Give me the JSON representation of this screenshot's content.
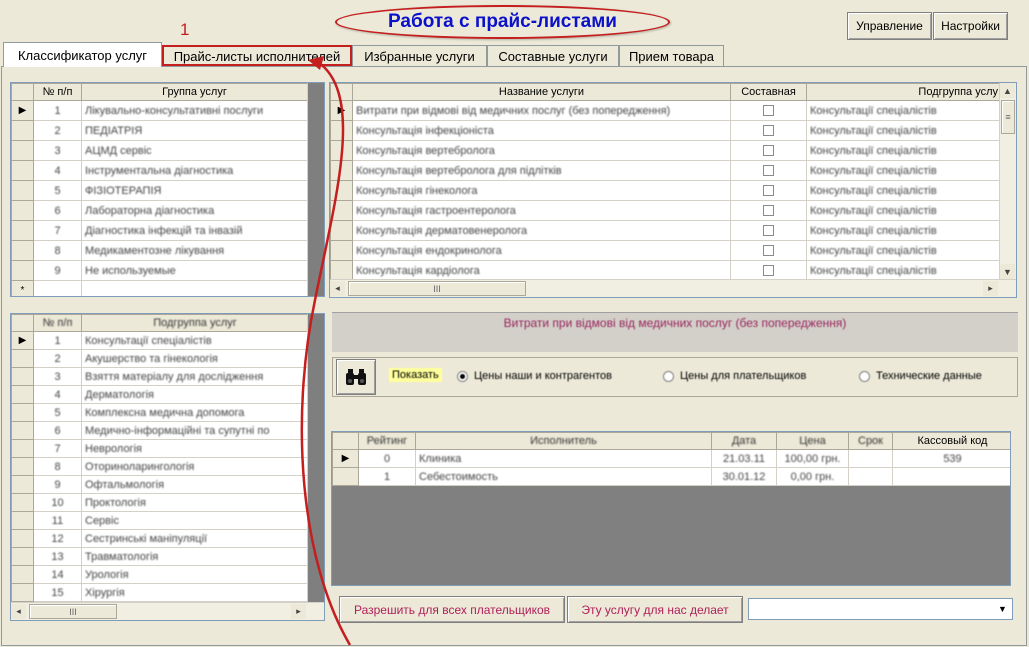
{
  "window": {
    "title": "Работа с прайс-листами",
    "annotation_number": "1",
    "buttons": {
      "manage": "Управление",
      "settings": "Настройки"
    }
  },
  "tabs": [
    {
      "label": "Классификатор услуг",
      "active": true
    },
    {
      "label": "Прайс-листы исполнителей",
      "highlighted": true
    },
    {
      "label": "Избранные услуги"
    },
    {
      "label": "Составные услуги"
    },
    {
      "label": "Прием товара"
    }
  ],
  "groups_grid": {
    "headers": {
      "num": "№ п/п",
      "name": "Группа услуг"
    },
    "rows": [
      {
        "num": "1",
        "name": "Лікувально-консультативні послуги"
      },
      {
        "num": "2",
        "name": "ПЕДІАТРІЯ"
      },
      {
        "num": "3",
        "name": "АЦМД сервіс"
      },
      {
        "num": "4",
        "name": "Інструментальна діагностика"
      },
      {
        "num": "5",
        "name": "ФІЗІОТЕРАПІЯ"
      },
      {
        "num": "6",
        "name": "Лабораторна діагностика"
      },
      {
        "num": "7",
        "name": "Діагностика інфекцій та інвазій"
      },
      {
        "num": "8",
        "name": "Медикаментозне лікування"
      },
      {
        "num": "9",
        "name": "Не используемые"
      }
    ],
    "new_row_marker": "*",
    "current_marker": "▶"
  },
  "subgroups_grid": {
    "headers": {
      "num": "№ п/п",
      "name": "Подгруппа услуг"
    },
    "rows": [
      {
        "num": "1",
        "name": "Консультації спеціалістів"
      },
      {
        "num": "2",
        "name": "Акушерство та гінекологія"
      },
      {
        "num": "3",
        "name": "Взяття матеріалу для дослідження"
      },
      {
        "num": "4",
        "name": "Дерматологія"
      },
      {
        "num": "5",
        "name": "Комплексна медична допомога"
      },
      {
        "num": "6",
        "name": "Медично-інформаційні та супутні по"
      },
      {
        "num": "7",
        "name": "Неврологія"
      },
      {
        "num": "8",
        "name": "Оториноларингологія"
      },
      {
        "num": "9",
        "name": "Офтальмологія"
      },
      {
        "num": "10",
        "name": "Проктологія"
      },
      {
        "num": "11",
        "name": "Сервіс"
      },
      {
        "num": "12",
        "name": "Сестринські маніпуляції"
      },
      {
        "num": "13",
        "name": "Травматологія"
      },
      {
        "num": "14",
        "name": "Урологія"
      },
      {
        "num": "15",
        "name": "Хірургія"
      }
    ]
  },
  "services_grid": {
    "headers": {
      "name": "Название услуги",
      "composite": "Составная",
      "subgroup": "Подгруппа услу"
    },
    "rows": [
      {
        "name": "Витрати при відмові від медичних послуг (без попередження)",
        "subgroup": "Консультації спеціалістів"
      },
      {
        "name": "Консультація інфекціоніста",
        "subgroup": "Консультації спеціалістів"
      },
      {
        "name": "Консультація вертебролога",
        "subgroup": "Консультації спеціалістів"
      },
      {
        "name": "Консультація вертебролога для підлітків",
        "subgroup": "Консультації спеціалістів"
      },
      {
        "name": "Консультація гінеколога",
        "subgroup": "Консультації спеціалістів"
      },
      {
        "name": "Консультація гастроентеролога",
        "subgroup": "Консультації спеціалістів"
      },
      {
        "name": "Консультація дерматовенеролога",
        "subgroup": "Консультації спеціалістів"
      },
      {
        "name": "Консультація ендокринолога",
        "subgroup": "Консультації спеціалістів"
      },
      {
        "name": "Консультація кардіолога",
        "subgroup": "Консультації спеціалістів"
      }
    ]
  },
  "selected_service_banner": "Витрати при відмові від медичних послуг (без попередження)",
  "filter": {
    "show_label": "Показать",
    "options": [
      {
        "label": "Цены наши и контрагентов",
        "checked": true
      },
      {
        "label": "Цены для плательщиков",
        "checked": false
      },
      {
        "label": "Технические данные",
        "checked": false
      }
    ]
  },
  "prices_grid": {
    "headers": {
      "rating": "Рейтинг",
      "executor": "Исполнитель",
      "date": "Дата",
      "price": "Цена",
      "term": "Срок",
      "cash_code": "Кассовый код"
    },
    "rows": [
      {
        "rating": "0",
        "executor": "Клиника",
        "date": "21.03.11",
        "price": "100,00 грн.",
        "term": "",
        "cash_code": "539"
      },
      {
        "rating": "1",
        "executor": "Себестоимость",
        "date": "30.01.12",
        "price": "0,00 грн.",
        "term": "",
        "cash_code": ""
      }
    ]
  },
  "bottom": {
    "allow_all_button": "Разрешить для всех плательщиков",
    "made_for_us_button": "Эту услугу для нас делает",
    "combo_value": ""
  },
  "scroll_glyph": "III",
  "colors": {
    "annotation_red": "#c41e1e",
    "title_blue": "#0b10c9",
    "button_text": "#b01f59"
  }
}
